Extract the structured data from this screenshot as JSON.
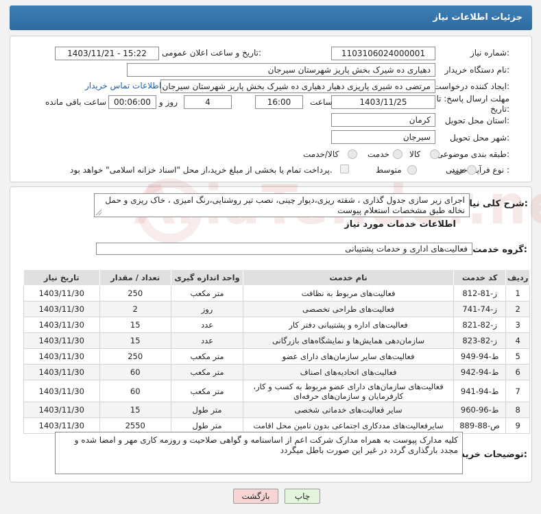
{
  "header": {
    "title": "جزئیات اطلاعات نیاز"
  },
  "form": {
    "need_number_label": "شماره نیاز:",
    "need_number": "1103106024000001",
    "announce_label": "تاریخ و ساعت اعلان عمومی:",
    "announce_value": "1403/11/21 - 15:22",
    "buyer_org_label": "نام دستگاه خریدار:",
    "buyer_org": "دهیاری ده شیرک بخش پاریز شهرستان سیرجان",
    "requester_label": "ایجاد کننده درخواست:",
    "requester": "مرتضی ده شیری پاریزی دهیار دهیاری ده شیرک بخش پاریز شهرستان سیرجان",
    "contact_link": "اطلاعات تماس خریدار",
    "deadline_label_line1": "مهلت ارسال پاسخ: تا",
    "deadline_label_line2": "تاریخ:",
    "deadline_date": "1403/11/25",
    "time_label": "ساعت",
    "deadline_time": "16:00",
    "days_value": "4",
    "days_label": "روز و",
    "remaining_time": "00:06:00",
    "remaining_label": "ساعت باقی مانده",
    "province_label": "استان محل تحویل:",
    "province": "کرمان",
    "city_label": "شهر محل تحویل:",
    "city": "سیرجان",
    "category_label": "طبقه بندی موضوعی:",
    "category_options": [
      "کالا",
      "خدمت",
      "کالا/خدمت"
    ],
    "purchase_type_label": "نوع فرآیند خرید :",
    "purchase_options": [
      "جزیی",
      "متوسط"
    ],
    "payment_note": "پرداخت تمام یا بخشی از مبلغ خرید،از محل \"اسناد خزانه اسلامی\" خواهد بود."
  },
  "summary": {
    "label": "شرح کلی نیاز:",
    "text": "اجرای زیر سازی جدول گذاری ، شفته ریزی،دیوار چینی، نصب تیر روشنایی،رنگ امیزی ، خاک ریزی و حمل نخاله طبق مشخصات استعلام پیوست"
  },
  "services": {
    "section_title": "اطلاعات خدمات مورد نیاز",
    "group_label": "گروه خدمت:",
    "group_value": "فعالیت‌های اداری و خدمات پشتیبانی",
    "columns": [
      "ردیف",
      "کد خدمت",
      "نام خدمت",
      "واحد اندازه گیری",
      "تعداد / مقدار",
      "تاریخ نیاز"
    ],
    "rows": [
      {
        "idx": "1",
        "code": "ز-81-812",
        "name": "فعالیت‌های مربوط به نظافت",
        "unit": "متر مکعب",
        "qty": "250",
        "date": "1403/11/30"
      },
      {
        "idx": "2",
        "code": "ز-74-741",
        "name": "فعالیت‌های طراحی تخصصی",
        "unit": "روز",
        "qty": "2",
        "date": "1403/11/30"
      },
      {
        "idx": "3",
        "code": "ز-82-821",
        "name": "فعالیت‌های اداره و پشتیبانی دفتر کار",
        "unit": "عدد",
        "qty": "15",
        "date": "1403/11/30"
      },
      {
        "idx": "4",
        "code": "ز-82-823",
        "name": "سازمان‌دهی همایش‌ها و نمایشگاه‌های بازرگانی",
        "unit": "عدد",
        "qty": "15",
        "date": "1403/11/30"
      },
      {
        "idx": "5",
        "code": "ط-94-949",
        "name": "فعالیت‌های سایر سازمان‌های دارای عضو",
        "unit": "متر مکعب",
        "qty": "250",
        "date": "1403/11/30"
      },
      {
        "idx": "6",
        "code": "ط-94-942",
        "name": "فعالیت‌های اتحادیه‌های اصناف",
        "unit": "متر مکعب",
        "qty": "60",
        "date": "1403/11/30"
      },
      {
        "idx": "7",
        "code": "ط-94-941",
        "name": "فعالیت‌های سازمان‌های دارای عضو مربوط به کسب و کار، کارفرمایان و سازمان‌های حرفه‌ای",
        "unit": "متر مکعب",
        "qty": "60",
        "date": "1403/11/30"
      },
      {
        "idx": "8",
        "code": "ط-96-960",
        "name": "سایر فعالیت‌های خدماتی شخصی",
        "unit": "متر طول",
        "qty": "15",
        "date": "1403/11/30"
      },
      {
        "idx": "9",
        "code": "ص-88-889",
        "name": "سایرفعالیت‌های مددکاری اجتماعی بدون تامین محل اقامت",
        "unit": "متر طول",
        "qty": "2550",
        "date": "1403/11/30"
      }
    ]
  },
  "buyer_notes": {
    "label": "توضیحات خریدار:",
    "text": "کلیه مدارک پیوست به همراه مدارک شرکت اعم از اساسنامه و گواهی صلاحیت و روزمه کاری مهر و امضا شده و مجدد بارگذاری گردد در غیر این صورت باطل میگردد"
  },
  "buttons": {
    "print": "چاپ",
    "back": "بازگشت"
  },
  "watermark": {
    "text": "AriaTender.neT"
  },
  "colors": {
    "header": "#2d6ba0",
    "link": "#1f5fa6",
    "back_button": "#f7d5d5",
    "print_button": "#e3f5dc"
  }
}
